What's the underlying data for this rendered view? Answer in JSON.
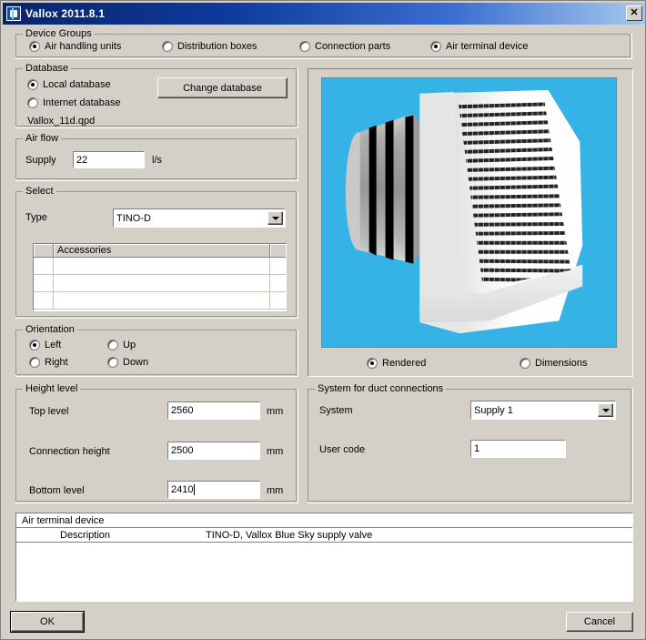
{
  "window": {
    "title": "Vallox 2011.8.1",
    "icon": "app-icon",
    "close_label": "✕"
  },
  "device_groups": {
    "legend": "Device Groups",
    "options": [
      {
        "label": "Air handling units",
        "checked": false
      },
      {
        "label": "Distribution boxes",
        "checked": false
      },
      {
        "label": "Connection parts",
        "checked": false
      },
      {
        "label": "Air terminal device",
        "checked": true
      }
    ]
  },
  "database": {
    "legend": "Database",
    "options": [
      {
        "label": "Local database",
        "checked": true
      },
      {
        "label": "Internet database",
        "checked": false
      }
    ],
    "file_name": "Vallox_11d.qpd",
    "change_button": "Change database"
  },
  "air_flow": {
    "legend": "Air flow",
    "supply_label": "Supply",
    "supply_value": "22",
    "unit": "l/s"
  },
  "select": {
    "legend": "Select",
    "type_label": "Type",
    "type_value": "TINO-D",
    "accessories": {
      "columns": [
        "",
        "Accessories",
        ""
      ],
      "rows": [
        [
          "",
          "",
          ""
        ],
        [
          "",
          "",
          ""
        ],
        [
          "",
          "",
          ""
        ]
      ]
    }
  },
  "orientation": {
    "legend": "Orientation",
    "options": [
      {
        "label": "Left",
        "checked": true
      },
      {
        "label": "Up",
        "checked": false
      },
      {
        "label": "Right",
        "checked": false
      },
      {
        "label": "Down",
        "checked": false
      }
    ]
  },
  "height_level": {
    "legend": "Height level",
    "fields": [
      {
        "label": "Top level",
        "value": "2560",
        "unit": "mm",
        "focused": false
      },
      {
        "label": "Connection height",
        "value": "2500",
        "unit": "mm",
        "focused": false
      },
      {
        "label": "Bottom level",
        "value": "2410",
        "unit": "mm",
        "focused": true
      }
    ]
  },
  "preview": {
    "background_color": "#35b3e7",
    "view_options": [
      {
        "label": "Rendered",
        "checked": true
      },
      {
        "label": "Dimensions",
        "checked": false
      }
    ]
  },
  "duct_system": {
    "legend": "System for duct connections",
    "system_label": "System",
    "system_value": "Supply 1",
    "user_code_label": "User code",
    "user_code_value": "1"
  },
  "details": {
    "header": "Air terminal device",
    "rows": [
      {
        "label": "Description",
        "value": "TINO-D, Vallox Blue Sky supply valve"
      }
    ]
  },
  "footer": {
    "ok_label": "OK",
    "cancel_label": "Cancel"
  }
}
